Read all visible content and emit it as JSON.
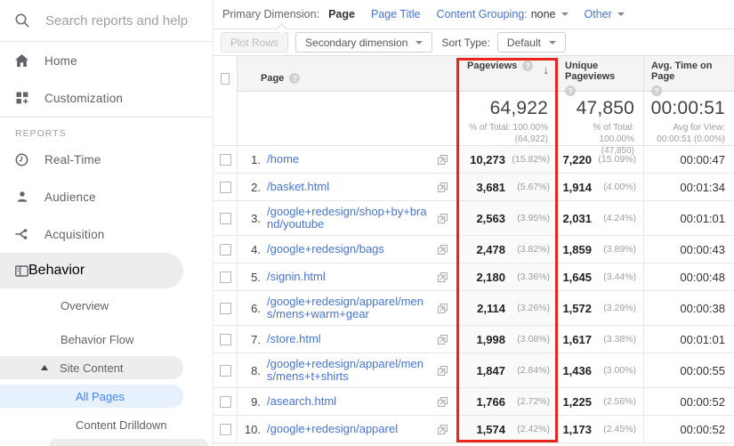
{
  "sidebar": {
    "search_placeholder": "Search reports and help",
    "home": "Home",
    "customization": "Customization",
    "reports_label": "REPORTS",
    "real_time": "Real-Time",
    "audience": "Audience",
    "acquisition": "Acquisition",
    "behavior": "Behavior",
    "overview": "Overview",
    "behavior_flow": "Behavior Flow",
    "site_content": "Site Content",
    "all_pages": "All Pages",
    "content_drilldown": "Content Drilldown"
  },
  "toolbar": {
    "primary_dimension_label": "Primary Dimension:",
    "primary_dimension_value": "Page",
    "page_title_link": "Page Title",
    "content_grouping_label": "Content Grouping:",
    "content_grouping_value": "none",
    "other_label": "Other"
  },
  "controls": {
    "plot_rows_label": "Plot Rows",
    "secondary_dimension_label": "Secondary dimension",
    "sort_type_label": "Sort Type:",
    "sort_type_value": "Default"
  },
  "table": {
    "columns": {
      "page": "Page",
      "pageviews": "Pageviews",
      "unique_pageviews": "Unique Pageviews",
      "avg_time": "Avg. Time on Page"
    },
    "sort": {
      "column": "Pageviews",
      "direction": "descending",
      "arrow": "↓"
    },
    "summary": {
      "pageviews_total": "64,922",
      "pageviews_sub1": "% of Total: 100.00%",
      "pageviews_sub2": "(64,922)",
      "unique_total": "47,850",
      "unique_sub1": "% of Total: 100.00%",
      "unique_sub2": "(47,850)",
      "avg_time_total": "00:00:51",
      "avg_time_sub1": "Avg for View:",
      "avg_time_sub2": "00:00:51 (0.00%)"
    },
    "rows": [
      {
        "index": "1.",
        "page": "/home",
        "pageviews": "10,273",
        "pageviews_pct": "(15.82%)",
        "unique": "7,220",
        "unique_pct": "(15.09%)",
        "avg_time": "00:00:47"
      },
      {
        "index": "2.",
        "page": "/basket.html",
        "pageviews": "3,681",
        "pageviews_pct": "(5.67%)",
        "unique": "1,914",
        "unique_pct": "(4.00%)",
        "avg_time": "00:01:34"
      },
      {
        "index": "3.",
        "page": "/google+redesign/shop+by+brand/youtube",
        "pageviews": "2,563",
        "pageviews_pct": "(3.95%)",
        "unique": "2,031",
        "unique_pct": "(4.24%)",
        "avg_time": "00:01:01"
      },
      {
        "index": "4.",
        "page": "/google+redesign/bags",
        "pageviews": "2,478",
        "pageviews_pct": "(3.82%)",
        "unique": "1,859",
        "unique_pct": "(3.89%)",
        "avg_time": "00:00:43"
      },
      {
        "index": "5.",
        "page": "/signin.html",
        "pageviews": "2,180",
        "pageviews_pct": "(3.36%)",
        "unique": "1,645",
        "unique_pct": "(3.44%)",
        "avg_time": "00:00:48"
      },
      {
        "index": "6.",
        "page": "/google+redesign/apparel/mens/mens+warm+gear",
        "pageviews": "2,114",
        "pageviews_pct": "(3.26%)",
        "unique": "1,572",
        "unique_pct": "(3.29%)",
        "avg_time": "00:00:38"
      },
      {
        "index": "7.",
        "page": "/store.html",
        "pageviews": "1,998",
        "pageviews_pct": "(3.08%)",
        "unique": "1,617",
        "unique_pct": "(3.38%)",
        "avg_time": "00:01:01"
      },
      {
        "index": "8.",
        "page": "/google+redesign/apparel/mens/mens+t+shirts",
        "pageviews": "1,847",
        "pageviews_pct": "(2.84%)",
        "unique": "1,436",
        "unique_pct": "(3.00%)",
        "avg_time": "00:00:55"
      },
      {
        "index": "9.",
        "page": "/asearch.html",
        "pageviews": "1,766",
        "pageviews_pct": "(2.72%)",
        "unique": "1,225",
        "unique_pct": "(2.56%)",
        "avg_time": "00:00:52"
      },
      {
        "index": "10.",
        "page": "/google+redesign/apparel",
        "pageviews": "1,574",
        "pageviews_pct": "(2.42%)",
        "unique": "1,173",
        "unique_pct": "(2.45%)",
        "avg_time": "00:00:52"
      }
    ]
  },
  "colors": {
    "accent_blue": "#4285f4",
    "link_blue": "#4674d1",
    "highlight_red": "#e8261c",
    "selected_nav_bg": "#e7f0fd",
    "nav_pill_gray": "#ededed"
  }
}
